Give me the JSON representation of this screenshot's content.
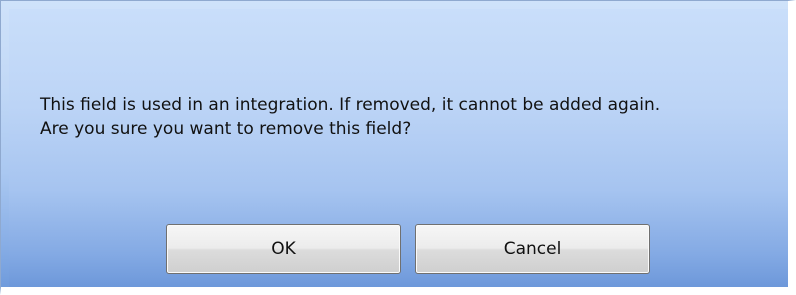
{
  "dialog": {
    "message_line1": "This field is used in an integration. If removed, it cannot be added again.",
    "message_line2": "Are you sure you want to remove this field?",
    "ok_label": "OK",
    "cancel_label": "Cancel"
  },
  "colors": {
    "gradient_top": "#c9defa",
    "gradient_bottom": "#6d98da",
    "button_face": "#e6e6e6",
    "text": "#111111"
  }
}
